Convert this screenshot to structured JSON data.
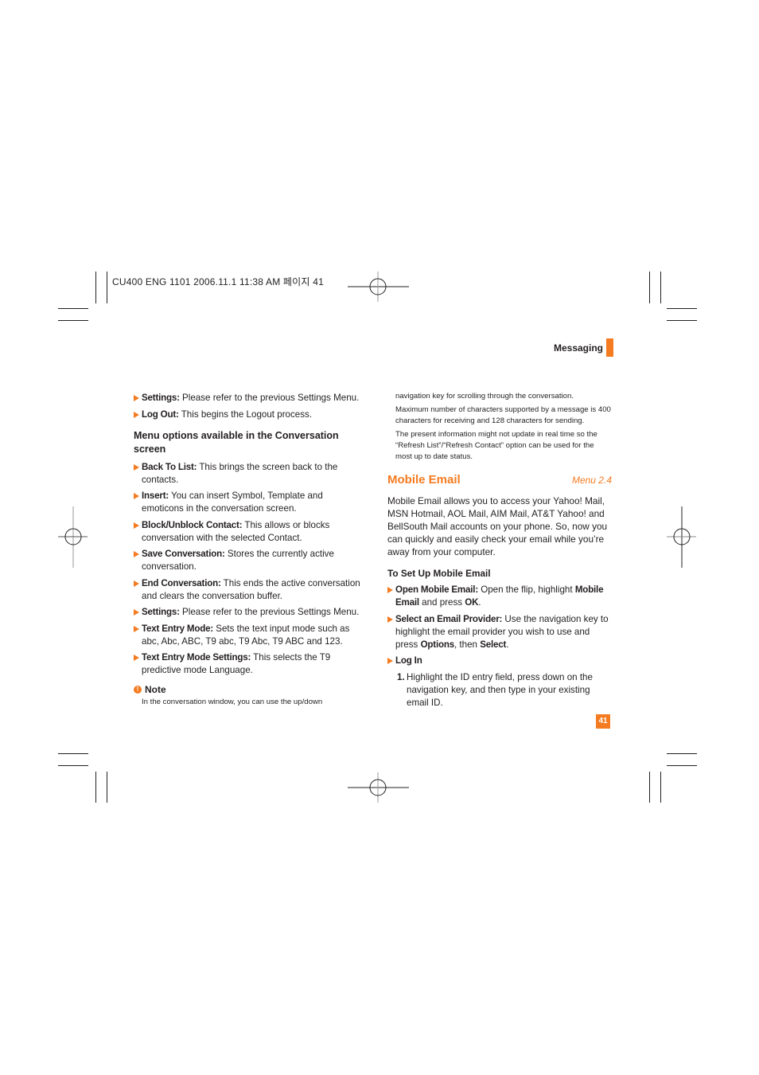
{
  "print_slug": "CU400 ENG 1101  2006.11.1  11:38 AM 페이지 41",
  "header": {
    "section": "Messaging",
    "accent_color": "#f47b20"
  },
  "left_column": {
    "bullets_top": [
      {
        "term": "Settings:",
        "text": " Please refer to the previous Settings Menu."
      },
      {
        "term": "Log Out:",
        "text": " This begins the Logout process."
      }
    ],
    "subheading": "Menu options available in the Conversation screen",
    "bullets": [
      {
        "term": "Back To List:",
        "text": " This brings the screen back to the contacts."
      },
      {
        "term": "Insert:",
        "text": " You can insert Symbol, Template and emoticons in the conversation screen."
      },
      {
        "term": "Block/Unblock Contact:",
        "text": " This allows or blocks conversation with the selected Contact."
      },
      {
        "term": "Save Conversation:",
        "text": " Stores the currently active conversation."
      },
      {
        "term": "End Conversation:",
        "text": " This ends the active conversation and clears the conversation buffer."
      },
      {
        "term": "Settings:",
        "text": " Please refer to the previous Settings Menu."
      },
      {
        "term": "Text Entry Mode:",
        "text": " Sets the text input mode such as abc, Abc, ABC, T9 abc, T9 Abc, T9 ABC and 123."
      },
      {
        "term": "Text Entry Mode Settings:",
        "text": " This selects the T9 predictive mode Language."
      }
    ],
    "note": {
      "icon": "!",
      "title": "Note",
      "text": "In the conversation window, you can use the up/down"
    }
  },
  "right_column": {
    "note_continued": [
      "navigation key for scrolling through the conversation.",
      "Maximum number of characters supported by a message is 400 characters for receiving and 128 characters for sending.",
      "The present information might not update in real time so the “Refresh List”/“Refresh Contact” option can be used for the most up to date status."
    ],
    "section_title": "Mobile Email",
    "menu_ref": "Menu 2.4",
    "intro": "Mobile Email allows you to access your Yahoo! Mail, MSN Hotmail, AOL Mail, AIM Mail, AT&T Yahoo! and BellSouth Mail accounts on your phone. So, now you can quickly and easily check your email while you’re away from your computer.",
    "setup_heading": "To Set Up Mobile Email",
    "steps": {
      "open": {
        "term": "Open Mobile Email:",
        "t1": " Open the flip, highlight ",
        "b1": "Mobile Email",
        "t2": " and press ",
        "b2": "OK",
        "t3": "."
      },
      "select": {
        "term": "Select an Email Provider:",
        "t1": " Use the navigation key to highlight the email provider you wish to use and press ",
        "b1": "Options",
        "t2": ", then ",
        "b2": "Select",
        "t3": "."
      },
      "login": {
        "term": "Log In"
      },
      "numbered": [
        {
          "num": "1.",
          "text": " Highlight the ID entry field, press down on the navigation key, and then type in your existing email ID."
        }
      ]
    }
  },
  "page_number": "41"
}
